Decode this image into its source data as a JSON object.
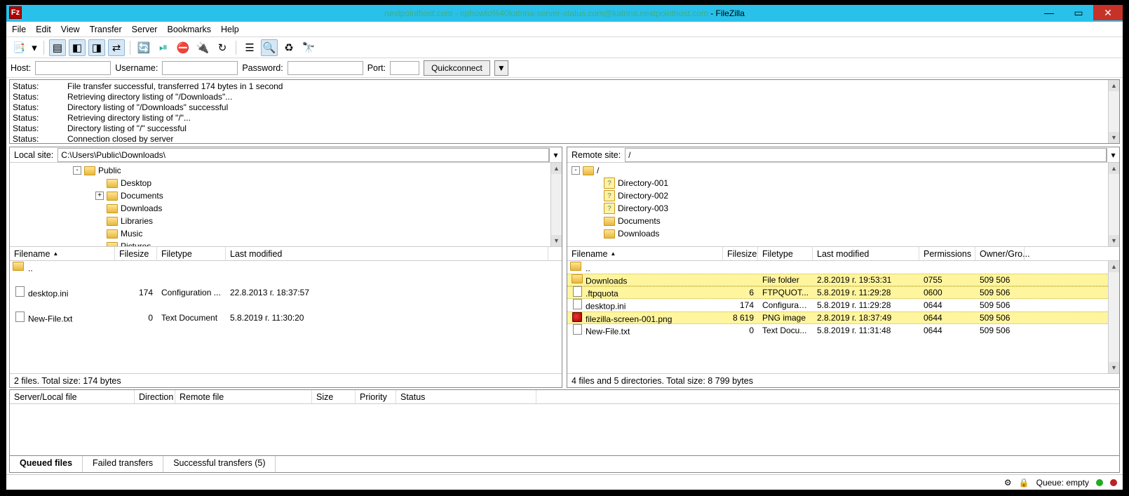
{
  "title": {
    "conn": "nextpointhost.com - nphowto%40katrina-server-status.com@katrina.nextpointhost.com",
    "app": " - FileZilla"
  },
  "menu": {
    "file": "File",
    "edit": "Edit",
    "view": "View",
    "transfer": "Transfer",
    "server": "Server",
    "bookmarks": "Bookmarks",
    "help": "Help"
  },
  "quick": {
    "host": "Host:",
    "user": "Username:",
    "pass": "Password:",
    "port": "Port:",
    "button": "Quickconnect"
  },
  "log": [
    {
      "k": "Status:",
      "v": "File transfer successful, transferred 174 bytes in 1 second"
    },
    {
      "k": "Status:",
      "v": "Retrieving directory listing of \"/Downloads\"..."
    },
    {
      "k": "Status:",
      "v": "Directory listing of \"/Downloads\" successful"
    },
    {
      "k": "Status:",
      "v": "Retrieving directory listing of \"/\"..."
    },
    {
      "k": "Status:",
      "v": "Directory listing of \"/\" successful"
    },
    {
      "k": "Status:",
      "v": "Connection closed by server"
    }
  ],
  "local": {
    "label": "Local site:",
    "path": "C:\\Users\\Public\\Downloads\\",
    "tree": [
      {
        "level": 0,
        "exp": "-",
        "label": "Public"
      },
      {
        "level": 1,
        "exp": "",
        "label": "Desktop"
      },
      {
        "level": 1,
        "exp": "+",
        "label": "Documents"
      },
      {
        "level": 1,
        "exp": "",
        "label": "Downloads"
      },
      {
        "level": 1,
        "exp": "",
        "label": "Libraries"
      },
      {
        "level": 1,
        "exp": "",
        "label": "Music"
      },
      {
        "level": 1,
        "exp": "",
        "label": "Pictures"
      }
    ],
    "cols": {
      "name": "Filename",
      "size": "Filesize",
      "type": "Filetype",
      "mod": "Last modified"
    },
    "widths": {
      "name": 150,
      "size": 60,
      "type": 98,
      "mod": 460
    },
    "rows": [
      {
        "dots": ".."
      },
      {
        "icon": "doc",
        "name": "desktop.ini",
        "size": "174",
        "type": "Configuration ...",
        "mod": "22.8.2013 г. 18:37:57"
      },
      {
        "icon": "doc",
        "name": "New-File.txt",
        "size": "0",
        "type": "Text Document",
        "mod": "5.8.2019 г. 11:30:20"
      }
    ],
    "summary": "2 files. Total size: 174 bytes"
  },
  "remote": {
    "label": "Remote site:",
    "path": "/",
    "tree": [
      {
        "level": 0,
        "exp": "-",
        "icon": "fld",
        "label": "/"
      },
      {
        "level": 1,
        "exp": "",
        "icon": "unk",
        "label": "Directory-001"
      },
      {
        "level": 1,
        "exp": "",
        "icon": "unk",
        "label": "Directory-002"
      },
      {
        "level": 1,
        "exp": "",
        "icon": "unk",
        "label": "Directory-003"
      },
      {
        "level": 1,
        "exp": "",
        "icon": "fld",
        "label": "Documents"
      },
      {
        "level": 1,
        "exp": "",
        "icon": "fld",
        "label": "Downloads"
      }
    ],
    "cols": {
      "name": "Filename",
      "size": "Filesize",
      "type": "Filetype",
      "mod": "Last modified",
      "perm": "Permissions",
      "owner": "Owner/Gro..."
    },
    "widths": {
      "name": 222,
      "size": 50,
      "type": 78,
      "mod": 152,
      "perm": 80,
      "owner": 70
    },
    "rows": [
      {
        "dots": ".."
      },
      {
        "hl": true,
        "icon": "fld",
        "name": "Downloads",
        "size": "",
        "type": "File folder",
        "mod": "2.8.2019 г. 19:53:31",
        "perm": "0755",
        "owner": "509 506"
      },
      {
        "hl": true,
        "icon": "doc",
        "name": ".ftpquota",
        "size": "6",
        "type": "FTPQUOT...",
        "mod": "5.8.2019 г. 11:29:28",
        "perm": "0600",
        "owner": "509 506"
      },
      {
        "hl": false,
        "icon": "doc",
        "name": "desktop.ini",
        "size": "174",
        "type": "Configurati...",
        "mod": "5.8.2019 г. 11:29:28",
        "perm": "0644",
        "owner": "509 506"
      },
      {
        "hl": true,
        "icon": "png",
        "name": "filezilla-screen-001.png",
        "size": "8 619",
        "type": "PNG image",
        "mod": "2.8.2019 г. 18:37:49",
        "perm": "0644",
        "owner": "509 506"
      },
      {
        "hl": false,
        "icon": "doc",
        "name": "New-File.txt",
        "size": "0",
        "type": "Text Docu...",
        "mod": "5.8.2019 г. 11:31:48",
        "perm": "0644",
        "owner": "509 506"
      }
    ],
    "summary": "4 files and 5 directories. Total size: 8 799 bytes"
  },
  "queue": {
    "cols": {
      "srv": "Server/Local file",
      "dir": "Direction",
      "rem": "Remote file",
      "size": "Size",
      "pri": "Priority",
      "stat": "Status"
    },
    "widths": {
      "srv": 178,
      "dir": 58,
      "rem": 195,
      "size": 62,
      "pri": 58,
      "stat": 200
    },
    "tabs": {
      "queued": "Queued files",
      "failed": "Failed transfers",
      "success": "Successful transfers (5)"
    }
  },
  "statusbar": {
    "queue": "Queue: empty"
  }
}
